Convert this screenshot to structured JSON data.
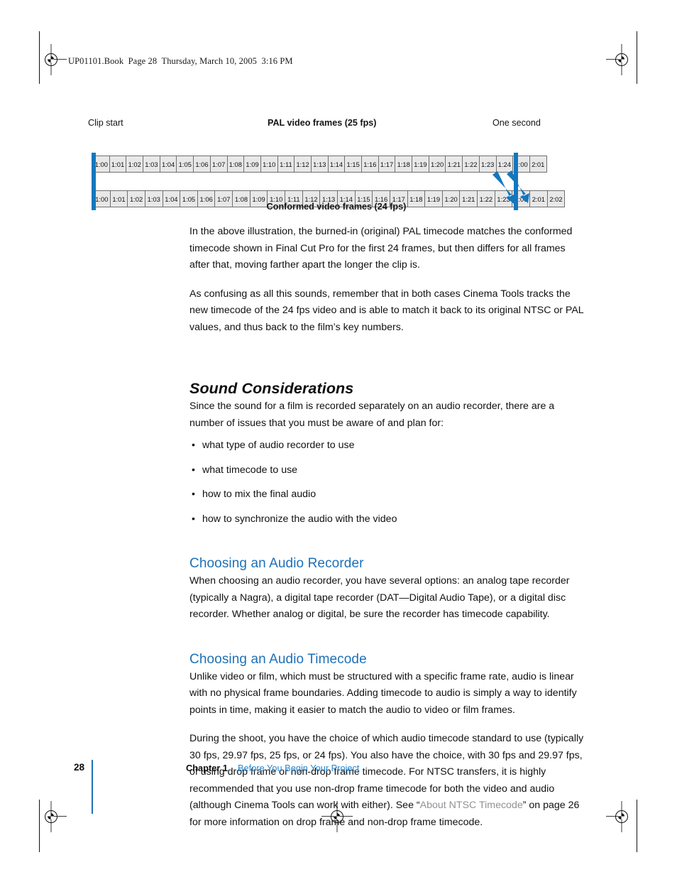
{
  "page": {
    "running_header": "UP01101.Book  Page 28  Thursday, March 10, 2005  3:16 PM",
    "accent_blue": "#1d71b8",
    "marker_blue": "#1277bf",
    "link_gray": "#8f9296",
    "frame_fill": "#e8e8e8"
  },
  "figure": {
    "label_clip_start": "Clip start",
    "label_pal_title": "PAL video frames (25 fps)",
    "label_one_second": "One second",
    "caption": "Conformed video frames (24 fps)",
    "top_row_frames": [
      "1:00",
      "1:01",
      "1:02",
      "1:03",
      "1:04",
      "1:05",
      "1:06",
      "1:07",
      "1:08",
      "1:09",
      "1:10",
      "1:11",
      "1:12",
      "1:13",
      "1:14",
      "1:15",
      "1:16",
      "1:17",
      "1:18",
      "1:19",
      "1:20",
      "1:21",
      "1:22",
      "1:23",
      "1:24",
      "2:00",
      "2:01"
    ],
    "bottom_row_frames": [
      "1:00",
      "1:01",
      "1:02",
      "1:03",
      "1:04",
      "1:05",
      "1:06",
      "1:07",
      "1:08",
      "1:09",
      "1:10",
      "1:11",
      "1:12",
      "1:13",
      "1:14",
      "1:15",
      "1:16",
      "1:17",
      "1:18",
      "1:19",
      "1:20",
      "1:21",
      "1:22",
      "1:23",
      "2:00",
      "2:01",
      "2:02"
    ],
    "arrow_count": 2
  },
  "body": {
    "para_1": "In the above illustration, the burned-in (original) PAL timecode matches the conformed timecode shown in Final Cut Pro for the first 24 frames, but then differs for all frames after that, moving farther apart the longer the clip is.",
    "para_2": "As confusing as all this sounds, remember that in both cases Cinema Tools tracks the new timecode of the 24 fps video and is able to match it back to its original NTSC or PAL values, and thus back to the film’s key numbers."
  },
  "sound_considerations": {
    "heading": "Sound Considerations",
    "intro": "Since the sound for a film is recorded separately on an audio recorder, there are a number of issues that you must be aware of and plan for:",
    "bullet_glyph": "•",
    "bullets": [
      "what type of audio recorder to use",
      "what timecode to use",
      "how to mix the final audio",
      "how to synchronize the audio with the video"
    ]
  },
  "choosing_recorder": {
    "heading": "Choosing an Audio Recorder",
    "para": "When choosing an audio recorder, you have several options:  an analog tape recorder (typically a Nagra), a digital tape recorder (DAT—Digital Audio Tape), or a digital disc recorder. Whether analog or digital, be sure the recorder has timecode capability."
  },
  "choosing_timecode": {
    "heading": "Choosing an Audio Timecode",
    "para_1": "Unlike video or film, which must be structured with a specific frame rate, audio is linear with no physical frame boundaries. Adding timecode to audio is simply a way to identify points in time, making it easier to match the audio to video or film frames.",
    "para_2_before": "During the shoot, you have the choice of which audio timecode standard to use (typically 30 fps, 29.97 fps, 25 fps, or 24 fps). You also have the choice, with 30 fps and 29.97 fps, of using drop frame or non-drop frame timecode. For NTSC transfers, it is highly recommended that you use non-drop frame timecode for both the video and audio (although Cinema Tools can work with either). See “",
    "link_text": "About NTSC Timecode",
    "para_2_after": "” on page 26 for more information on drop frame and non-drop frame timecode."
  },
  "footer": {
    "page_number": "28",
    "chapter_label": "Chapter 1",
    "chapter_title": "Before You Begin Your Project"
  }
}
